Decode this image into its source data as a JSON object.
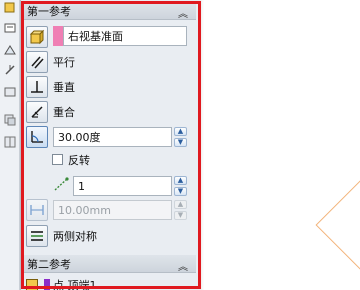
{
  "section1": {
    "title": "第一参考",
    "reference_value": "右视基准面",
    "reference_color": "#ef7fb4",
    "constraints": [
      {
        "label": "平行",
        "icon": "parallel-icon"
      },
      {
        "label": "垂直",
        "icon": "perpendicular-icon"
      },
      {
        "label": "重合",
        "icon": "coincident-icon"
      }
    ],
    "angle_value": "30.00度",
    "flip_label": "反转",
    "flip_checked": false,
    "instance_count": "1",
    "distance_value": "10.00mm",
    "symmetric_label": "两侧对称"
  },
  "section2": {
    "title": "第二参考",
    "reference_value": "点 顶端1"
  },
  "colors": {
    "frame": "#e0191f",
    "panel_bg": "#e9edf2",
    "header_bg": "#d4dae1"
  }
}
